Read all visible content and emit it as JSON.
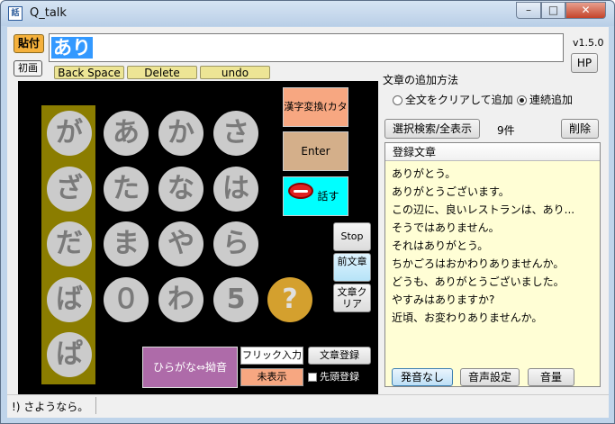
{
  "window": {
    "title": "Q_talk",
    "icon": "app-icon"
  },
  "toolbar": {
    "paste": "貼付",
    "first": "初画",
    "backspace": "Back Space",
    "delete": "Delete",
    "undo": "undo",
    "version": "v1.5.0",
    "hp": "HP"
  },
  "input": {
    "value": "あり"
  },
  "keyboard": {
    "keys": [
      "が",
      "あ",
      "か",
      "さ",
      "ざ",
      "た",
      "な",
      "は",
      "だ",
      "ま",
      "や",
      "ら",
      "ば",
      "０",
      "わ",
      "5",
      "?",
      "ぱ"
    ]
  },
  "side": {
    "kanji": "漢字変換(カタカナ)",
    "enter": "Enter",
    "speak": "話す",
    "stop": "Stop",
    "prev": "前文章",
    "clear": "文章クリア"
  },
  "mode": {
    "hira": "ひらがな⇔拗音",
    "flick": "フリック入力",
    "regsent": "文章登録",
    "unshown": "未表示",
    "first_reg": "先頭登録"
  },
  "add_method": {
    "title": "文章の追加方法",
    "options": [
      "全文をクリアして追加",
      "連続追加"
    ],
    "selected": 1
  },
  "list": {
    "search": "選択検索/全表示",
    "count": "9件",
    "delete": "削除",
    "header": "登録文章",
    "items": [
      "ありがとう。",
      "ありがとうございます。",
      "この辺に、良いレストランは、あり...",
      "そうではありません。",
      "それはありがとう。",
      "ちかごろはおかわりありませんか。",
      "どうも、ありがとうございました。",
      "やすみはありますか?",
      "近頃、お変わりありませんか。"
    ]
  },
  "sound": {
    "nosound": "発音なし",
    "voice": "音声設定",
    "volume": "音量"
  },
  "status": {
    "text": "!) さようなら。"
  }
}
